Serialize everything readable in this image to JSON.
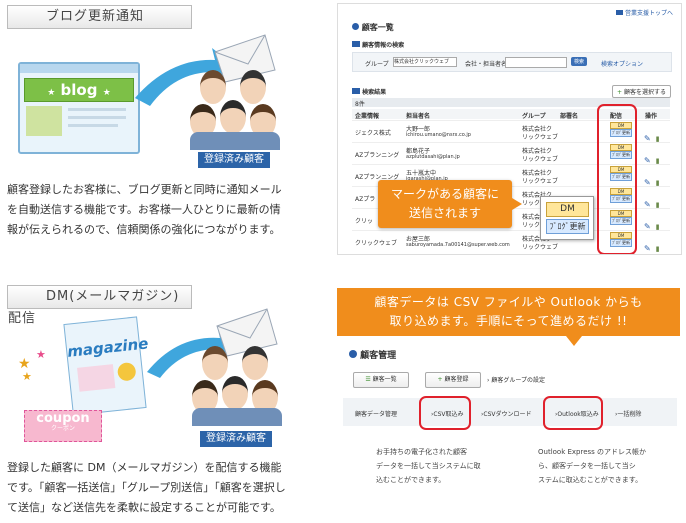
{
  "blog_section": {
    "title": "ブログ更新通知",
    "blog_word": "blog",
    "registered_badge": "登録済み顧客",
    "desc": [
      "顧客登録したお客様に、ブログ更新と同時に通知メール",
      "を自動送信する機能です。お客様一人ひとりに最新の情",
      "報が伝えられるので、信頼関係の強化につながります。"
    ]
  },
  "dm_section": {
    "title": "DM(メールマガジン)配信",
    "magazine_word": "magazine",
    "coupon_word": "coupon",
    "coupon_sub": "クーポン",
    "registered_badge": "登録済み顧客",
    "desc": [
      "登録した顧客に DM（メールマガジン）を配信する機能",
      "です。「顧客一括送信」「グループ別送信」「顧客を選択し",
      "て送信」など送信先を柔軟に設定することが可能です。"
    ]
  },
  "customer_list": {
    "top_link": "営業支援トップへ",
    "title": "顧客一覧",
    "search_heading": "顧客情報の検索",
    "group_label": "グループ",
    "group_value": "株式会社クリックウェブ",
    "name_label": "会社・担当者名",
    "search_btn": "検索",
    "options_link": "検索オプション",
    "results_heading": "検索結果",
    "select_btn": "顧客を選択する",
    "count": "8件",
    "columns": [
      "企業情報",
      "担当者名",
      "グループ",
      "部署名",
      "配信",
      "操作"
    ],
    "rows": [
      {
        "company": "ジェクス株式",
        "person": "大野一郎",
        "email": "ichirou.umano@nsrx.co.jp",
        "group": "株式会社ク",
        "group2": "リックウェブ"
      },
      {
        "company": "AZプランニング",
        "person": "都島花子",
        "email": "azplutdasahi@plan.jp",
        "group": "株式会社ク",
        "group2": "リックウェブ"
      },
      {
        "company": "AZプランニング",
        "person": "五十嵐太中",
        "email": "igarashi@plan.jp",
        "group": "株式会社ク",
        "group2": "リックウェブ"
      },
      {
        "company": "AZプラ",
        "person": "",
        "email": "",
        "group": "株式会社ク",
        "group2": "リックウェブ"
      },
      {
        "company": "クリッ",
        "person": "",
        "email": "",
        "group": "株式会社ク",
        "group2": "リックウェブ"
      },
      {
        "company": "クリックウェブ",
        "person": "お屋三郎",
        "email": "saburoyamada.7a00141@super.web.com",
        "group": "株式会社ク",
        "group2": "リックウェブ"
      }
    ],
    "dm_tag": "DM",
    "blog_tag": "ﾌﾞﾛｸﾞ更新",
    "callout_lines": [
      "マークがある顧客に",
      "送信されます"
    ],
    "popup_dm": "DM",
    "popup_blog": "ﾌﾞﾛｸﾞ更新"
  },
  "customer_mgmt": {
    "banner_lines": [
      "顧客データは CSV ファイルや Outlook からも",
      "取り込めます。手順にそって進めるだけ !!"
    ],
    "title": "顧客管理",
    "btn_list": "顧客一覧",
    "btn_register": "顧客登録",
    "group_setting": "顧客グループの設定",
    "data_label": "顧客データ管理",
    "csv_import": "CSV取込み",
    "csv_download": "CSVダウンロード",
    "outlook_import": "Outlook取込み",
    "bulk_delete": "一括削除",
    "note_left": [
      "お手持ちの電子化された顧客",
      "データを一括して当システムに取",
      "込むことができます。"
    ],
    "note_right": [
      "Outlook Express のアドレス帳か",
      "ら、顧客データを一括して当シ",
      "ステムに取込むことができます。"
    ]
  }
}
